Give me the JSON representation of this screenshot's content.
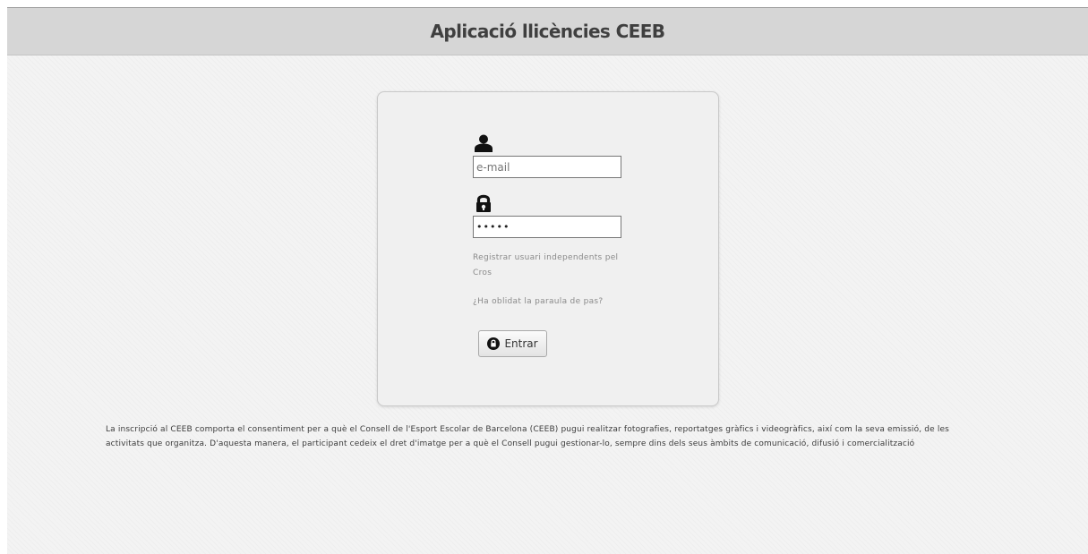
{
  "header": {
    "title": "Aplicació llicències CEEB"
  },
  "login": {
    "user_icon": "user-icon",
    "lock_icon": "lock-icon",
    "email_placeholder": "e-mail",
    "password_value": "•••••",
    "register_link": "Registrar usuari independents pel Cros",
    "forgot_link": "¿Ha oblidat la paraula de pas?",
    "submit_icon": "enter-icon",
    "submit_label": "Entrar"
  },
  "disclaimer": {
    "text": "La inscripció al CEEB comporta el consentiment per a què el Consell de l'Esport Escolar de Barcelona (CEEB) pugui realitzar fotografies, reportatges gràfics i videogràfics, així com la seva emissió, de les activitats que organitza. D'aquesta manera, el participant cedeix el dret d'imatge per a què el Consell pugui gestionar-lo, sempre dins dels seus àmbits de comunicació, difusió i comercialització"
  },
  "colors": {
    "header_background": "#d6d6d6",
    "page_background": "#f3f3f3",
    "card_background": "#f0f0f0"
  }
}
